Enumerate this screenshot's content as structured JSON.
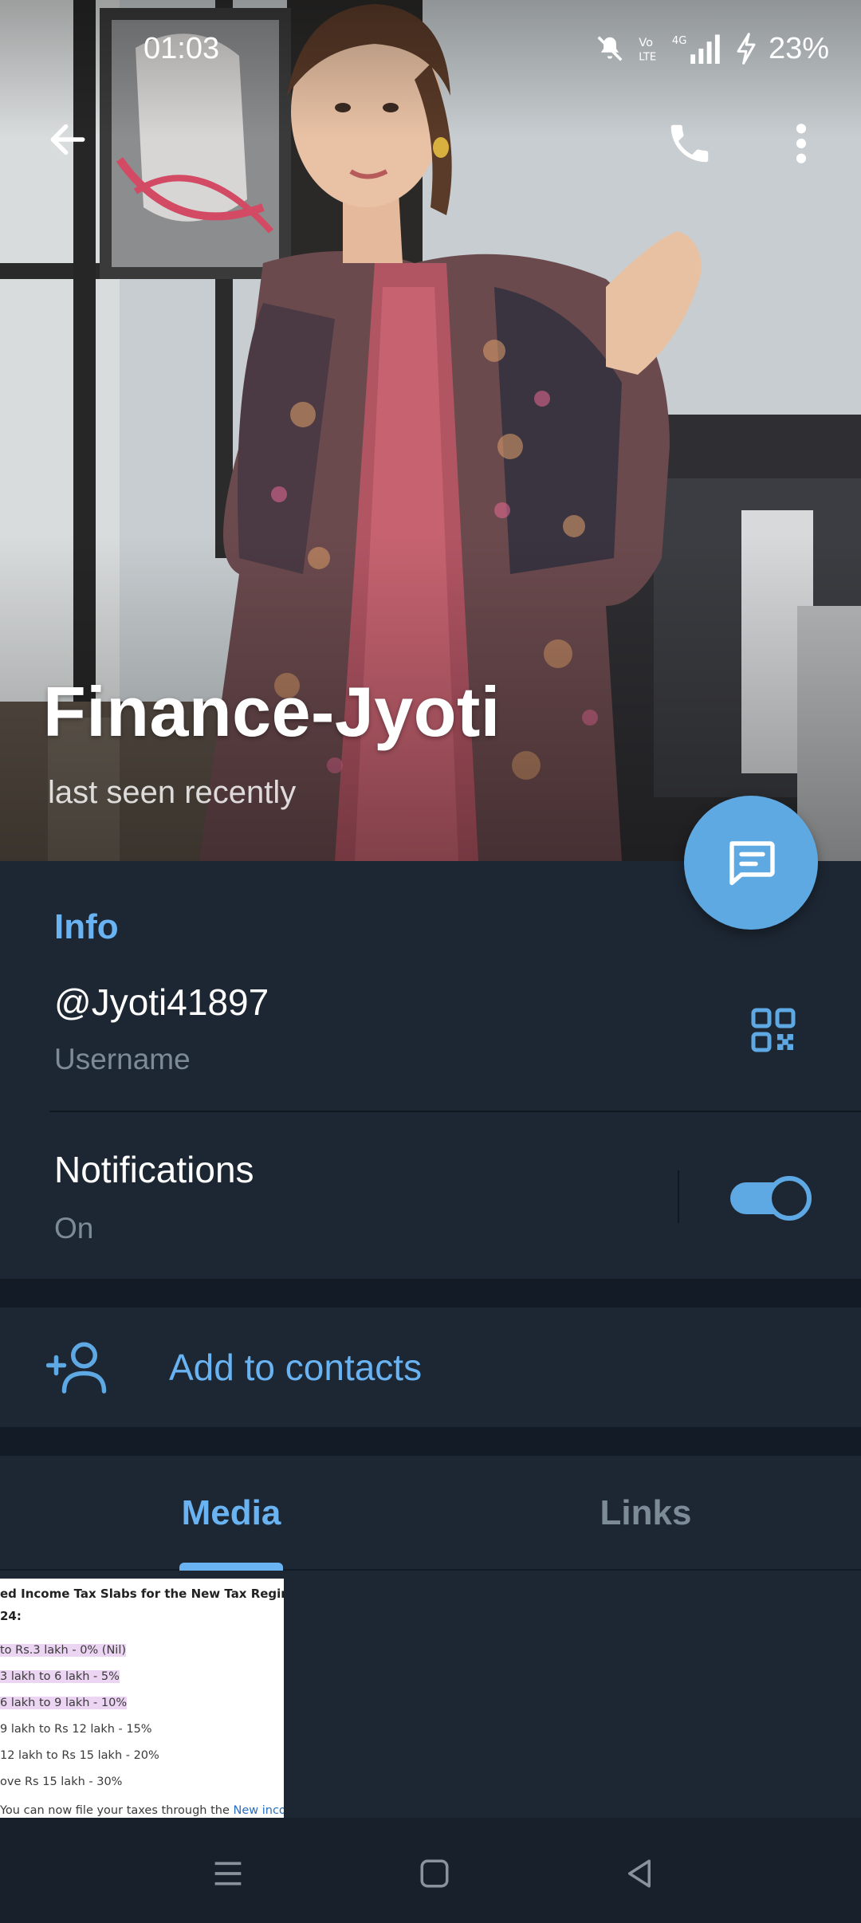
{
  "status_bar": {
    "time": "01:03",
    "battery": "23%",
    "network": "4G",
    "icons": [
      "mute-icon",
      "volte-icon",
      "signal-icon",
      "charging-icon"
    ]
  },
  "header": {
    "back_icon": "arrow-left-icon",
    "call_icon": "phone-icon",
    "more_icon": "more-vertical-icon"
  },
  "profile": {
    "name": "Finance-Jyoti",
    "status": "last seen recently"
  },
  "info": {
    "section_title": "Info",
    "username": "@Jyoti41897",
    "username_label": "Username",
    "notifications_title": "Notifications",
    "notifications_state": "On",
    "notifications_enabled": true
  },
  "actions": {
    "add_to_contacts": "Add to contacts"
  },
  "tabs": [
    {
      "label": "Media",
      "active": true
    },
    {
      "label": "Links",
      "active": false
    }
  ],
  "media_thumb": {
    "lines": [
      "ed Income Tax Slabs for the New Tax Regime (defau",
      "24:",
      "to Rs.3 lakh - 0% (Nil)",
      "3 lakh to 6 lakh - 5%",
      "6 lakh to 9 lakh - 10%",
      "9 lakh to Rs 12 lakh - 15%",
      "12 lakh to Rs 15 lakh - 20%",
      "ove Rs 15 lakh - 30%",
      "You can now file your taxes through the ",
      "New incom"
    ]
  },
  "colors": {
    "background": "#1d2733",
    "accent": "#6ab3f3",
    "fab": "#5fa9e3",
    "secondary_text": "#7d8b99"
  }
}
